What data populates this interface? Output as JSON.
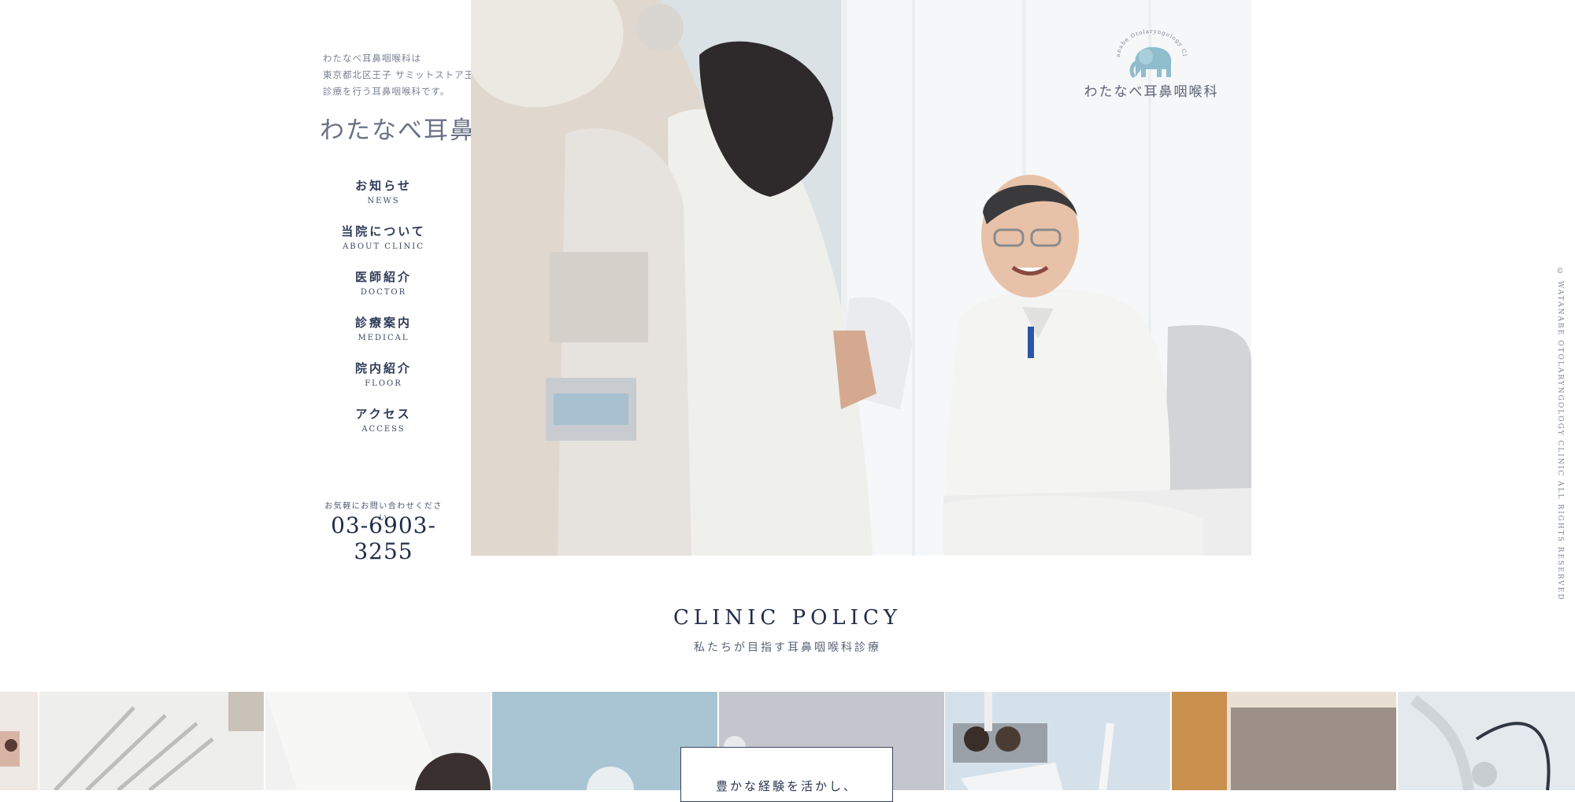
{
  "intro": {
    "lines": [
      "わたなべ耳鼻咽喉科は",
      "東京都北区王子 サミットストア王子桜田通り店で",
      "診療を行う耳鼻咽喉科です。"
    ]
  },
  "site_title": "わたなべ耳鼻咽喉科",
  "nav": {
    "items": [
      {
        "ja": "お知らせ",
        "en": "NEWS"
      },
      {
        "ja": "当院について",
        "en": "ABOUT CLINIC"
      },
      {
        "ja": "医師紹介",
        "en": "DOCTOR"
      },
      {
        "ja": "診療案内",
        "en": "MEDICAL"
      },
      {
        "ja": "院内紹介",
        "en": "FLOOR"
      },
      {
        "ja": "アクセス",
        "en": "ACCESS"
      }
    ]
  },
  "contact": {
    "lead": "お気軽にお問い合わせください",
    "phone": "03-6903-3255"
  },
  "logo": {
    "arc_text": "Watanabe Otolaryngology Clinic",
    "name": "わたなべ耳鼻咽喉科",
    "icon": "elephant-icon",
    "color": "#8fbdcc"
  },
  "copyright": "© WATANABE OTOLARYNGOLOGY CLINIC ALL RIGHTS RESERVED",
  "policy": {
    "title": "CLINIC POLICY",
    "subtitle": "私たちが目指す耳鼻咽喉科診療"
  },
  "card": {
    "text": "豊かな経験を活かし、"
  },
  "colors": {
    "navy": "#1f2b4a",
    "text_gray": "#7a8194",
    "accent_blue": "#8fbdcc"
  }
}
